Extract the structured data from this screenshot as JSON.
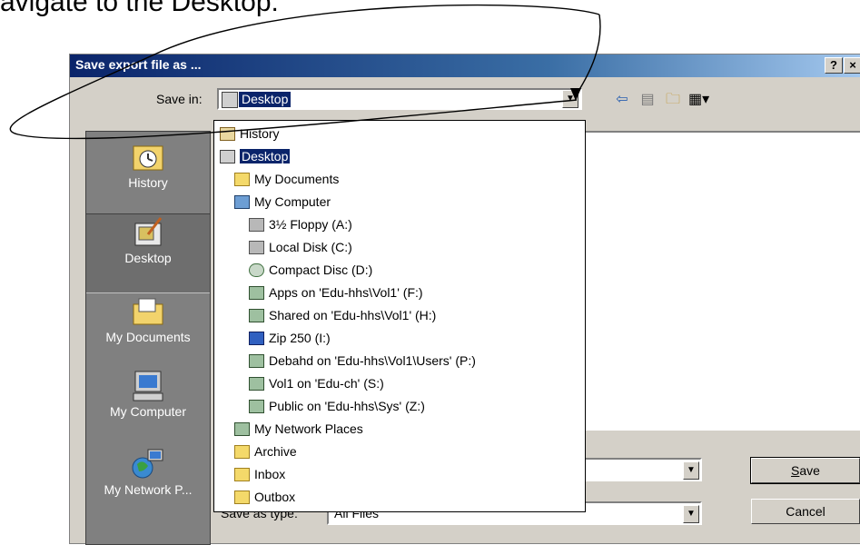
{
  "caption": "avigate to the Desktop.",
  "dialog": {
    "title": "Save export file as ...",
    "help_button": "?",
    "close_button": "×",
    "save_in_label": "Save in:",
    "save_in_value": "Desktop",
    "dropdown_arrow": "▼"
  },
  "places": [
    {
      "label": "History",
      "icon": "history-icon"
    },
    {
      "label": "Desktop",
      "icon": "desktop-icon"
    },
    {
      "label": "My Documents",
      "icon": "my-documents-icon"
    },
    {
      "label": "My Computer",
      "icon": "my-computer-icon"
    },
    {
      "label": "My Network P...",
      "icon": "network-places-icon"
    }
  ],
  "dropdown_items": [
    {
      "label": "History",
      "indent": 0,
      "icon": "hist"
    },
    {
      "label": "Desktop",
      "indent": 0,
      "icon": "desk",
      "selected": true
    },
    {
      "label": "My Documents",
      "indent": 1,
      "icon": "folder"
    },
    {
      "label": "My Computer",
      "indent": 1,
      "icon": "pc"
    },
    {
      "label": "3½ Floppy (A:)",
      "indent": 2,
      "icon": "drive"
    },
    {
      "label": "Local Disk (C:)",
      "indent": 2,
      "icon": "drive"
    },
    {
      "label": "Compact Disc (D:)",
      "indent": 2,
      "icon": "cd"
    },
    {
      "label": "Apps on 'Edu-hhs\\Vol1' (F:)",
      "indent": 2,
      "icon": "net"
    },
    {
      "label": "Shared on 'Edu-hhs\\Vol1' (H:)",
      "indent": 2,
      "icon": "net"
    },
    {
      "label": "Zip 250  (I:)",
      "indent": 2,
      "icon": "zip"
    },
    {
      "label": "Debahd on 'Edu-hhs\\Vol1\\Users' (P:)",
      "indent": 2,
      "icon": "net"
    },
    {
      "label": "Vol1 on 'Edu-ch' (S:)",
      "indent": 2,
      "icon": "net"
    },
    {
      "label": "Public on 'Edu-hhs\\Sys' (Z:)",
      "indent": 2,
      "icon": "net"
    },
    {
      "label": "My Network Places",
      "indent": 1,
      "icon": "net"
    },
    {
      "label": "Archive",
      "indent": 1,
      "icon": "folder"
    },
    {
      "label": "Inbox",
      "indent": 1,
      "icon": "folder"
    },
    {
      "label": "Outbox",
      "indent": 1,
      "icon": "folder"
    }
  ],
  "bottom": {
    "save_as_type_label": "Save as type:",
    "save_as_type_value": "All Files",
    "save_button": "Save",
    "save_button_mnemonic": "S",
    "cancel_button": "Cancel"
  },
  "toolbar": {
    "back_icon": "back-arrow-icon",
    "up_folder_icon": "up-folder-icon",
    "new_folder_icon": "new-folder-icon",
    "view_menu_icon": "view-menu-icon"
  }
}
